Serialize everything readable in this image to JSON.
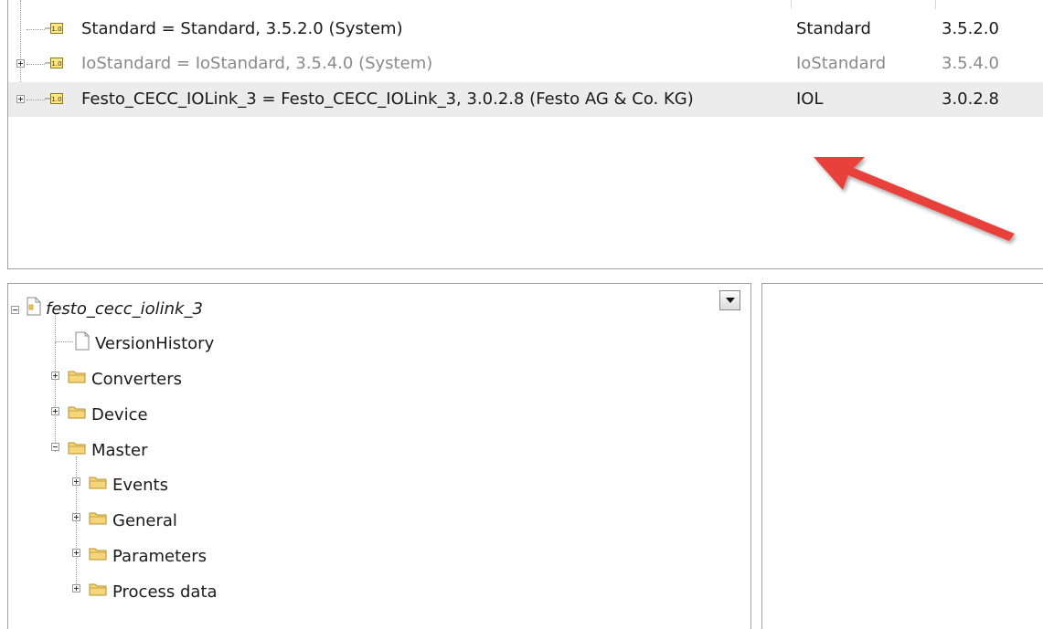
{
  "libraries": [
    {
      "name": "Standard = Standard, 3.5.2.0 (System)",
      "namespace": "Standard",
      "version": "3.5.2.0",
      "expandable": false,
      "dimmed": false,
      "selected": false
    },
    {
      "name": "IoStandard = IoStandard, 3.5.4.0 (System)",
      "namespace": "IoStandard",
      "version": "3.5.4.0",
      "expandable": true,
      "dimmed": true,
      "selected": false
    },
    {
      "name": "Festo_CECC_IOLink_3 = Festo_CECC_IOLink_3, 3.0.2.8 (Festo AG & Co. KG)",
      "namespace": "IOL",
      "version": "3.0.2.8",
      "expandable": true,
      "dimmed": false,
      "selected": true
    }
  ],
  "library_icon_label": "1.0",
  "tree": {
    "root": "festo_cecc_iolink_3",
    "version_history": "VersionHistory",
    "converters": "Converters",
    "device": "Device",
    "master": "Master",
    "events": "Events",
    "general": "General",
    "parameters": "Parameters",
    "process_data": "Process data"
  },
  "colors": {
    "arrow": "#e8403b",
    "selection": "#ececec",
    "folder": "#f5d67a"
  }
}
